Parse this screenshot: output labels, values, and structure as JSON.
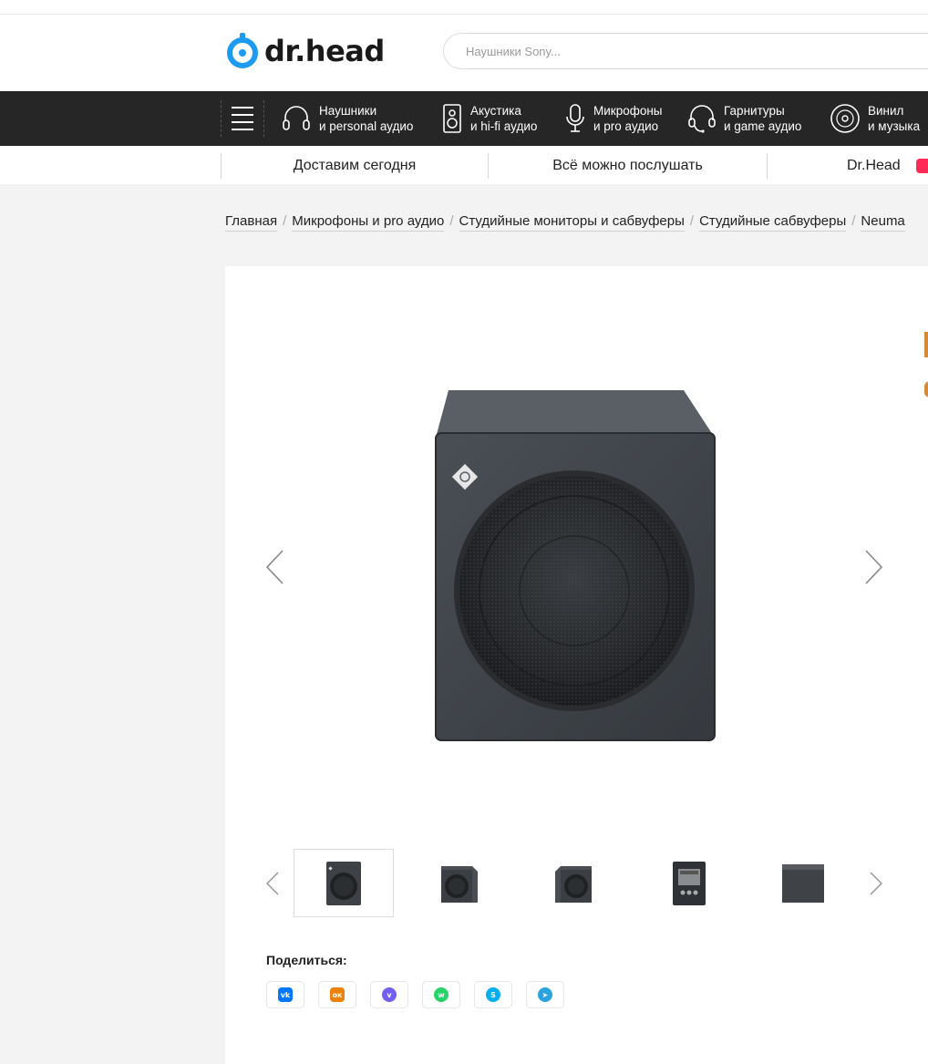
{
  "header": {
    "logo_text": "dr.head",
    "search_placeholder": "Наушники Sony..."
  },
  "catnav": {
    "items": [
      {
        "line1": "Наушники",
        "line2": "и personal аудио",
        "icon": "headphones-icon"
      },
      {
        "line1": "Акустика",
        "line2": "и hi-fi аудио",
        "icon": "speaker-icon"
      },
      {
        "line1": "Микрофоны",
        "line2": "и pro аудио",
        "icon": "microphone-icon"
      },
      {
        "line1": "Гарнитуры",
        "line2": "и game аудио",
        "icon": "headset-icon"
      },
      {
        "line1": "Винил",
        "line2": "и музыка",
        "icon": "vinyl-icon"
      }
    ]
  },
  "subnav": {
    "items": [
      "Доставим сегодня",
      "Всё можно послушать",
      "Dr.Head"
    ]
  },
  "breadcrumbs": [
    "Главная",
    "Микрофоны и pro аудио",
    "Студийные мониторы и сабвуферы",
    "Студийные сабвуферы",
    "Neuma"
  ],
  "share": {
    "title": "Поделиться:",
    "buttons": [
      {
        "name": "vk",
        "label": "vk",
        "color": "#0077ff"
      },
      {
        "name": "ok",
        "label": "ок",
        "color": "#ee8208"
      },
      {
        "name": "viber",
        "label": "v",
        "color": "#7360f2"
      },
      {
        "name": "whatsapp",
        "label": "w",
        "color": "#25d366"
      },
      {
        "name": "skype",
        "label": "S",
        "color": "#00aff0"
      },
      {
        "name": "telegram",
        "label": "➤",
        "color": "#2aa3df"
      }
    ]
  },
  "colors": {
    "accent": "#1d9bf0",
    "nav_bg": "#262626",
    "badge": "#ff2a55"
  }
}
